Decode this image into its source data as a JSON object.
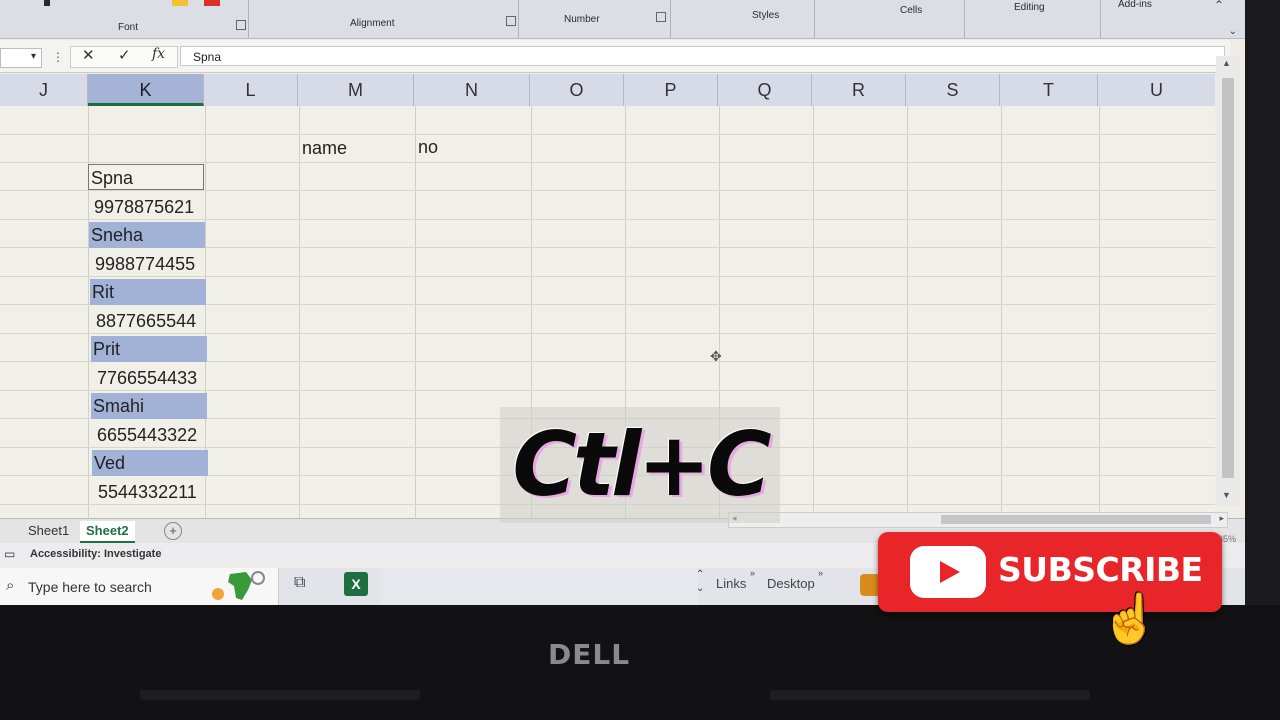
{
  "ribbon": {
    "groups": [
      {
        "label": "Font"
      },
      {
        "label": "Alignment"
      },
      {
        "label": "Number"
      },
      {
        "label": "Styles"
      },
      {
        "label": "Cells"
      },
      {
        "label": "Editing"
      },
      {
        "label": "Add-ins"
      }
    ]
  },
  "formula_bar": {
    "cancel": "✕",
    "enter": "✓",
    "fx": "fx",
    "value": "Spna"
  },
  "columns": [
    "J",
    "K",
    "L",
    "M",
    "N",
    "O",
    "P",
    "Q",
    "R",
    "S",
    "T",
    "U"
  ],
  "cells": {
    "m_header": "name",
    "n_header": "no",
    "k": [
      "Spna",
      "9978875621",
      "Sneha",
      "9988774455",
      "Rit",
      "8877665544",
      "Prit",
      "7766554433",
      "Smahi",
      "6655443322",
      "Ved",
      "5544332211"
    ]
  },
  "sheets": {
    "tabs": [
      "Sheet1",
      "Sheet2"
    ],
    "active": "Sheet2"
  },
  "status": {
    "accessibility": "Accessibility: Investigate",
    "zoom": "85%"
  },
  "taskbar": {
    "search_placeholder": "Type here to search",
    "links": "Links",
    "desktop": "Desktop"
  },
  "overlay": {
    "shortcut": "Ctl+C",
    "subscribe": "SUBSCRIBE"
  },
  "bezel": {
    "brand": "DELL"
  },
  "colors": {
    "selected_cell_fill": "#a1b2d6",
    "excel_green": "#1e7145",
    "subscribe_red": "#e8262a"
  }
}
